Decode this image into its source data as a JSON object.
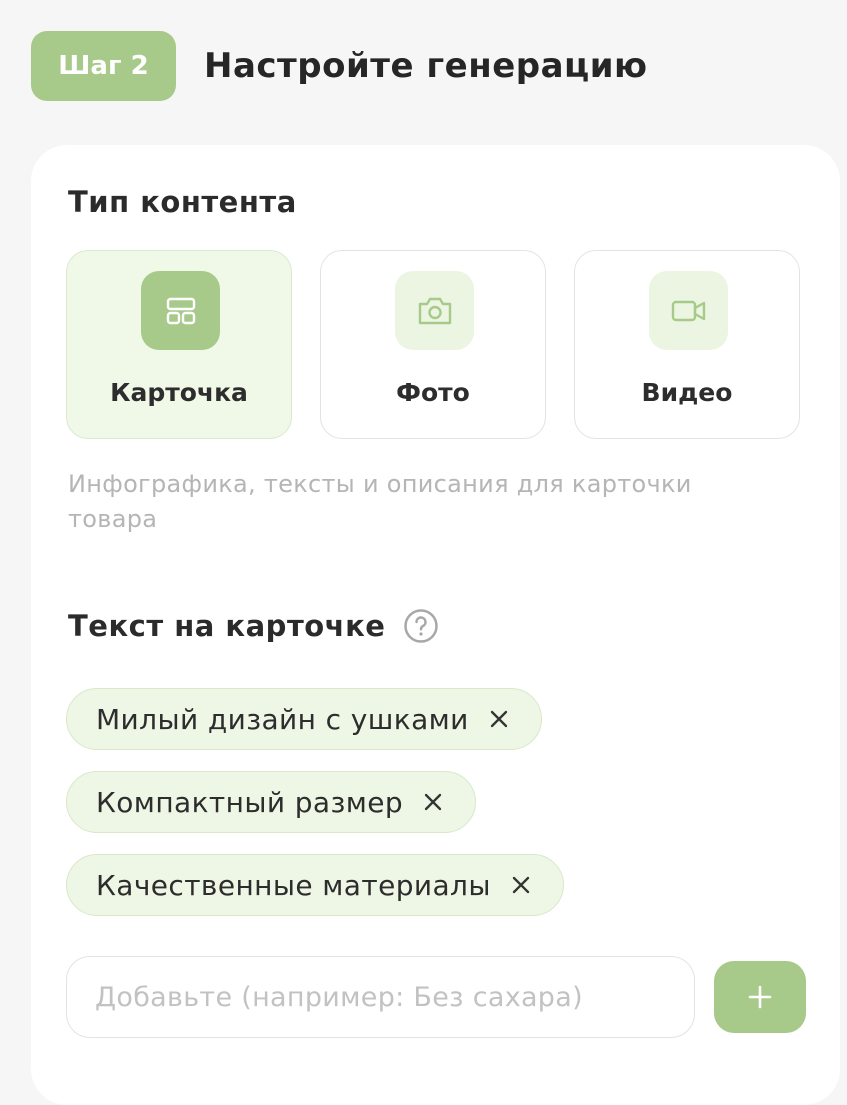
{
  "header": {
    "step_label": "Шаг 2",
    "title": "Настройте генерацию"
  },
  "content_type": {
    "title": "Тип контента",
    "options": [
      {
        "label": "Карточка",
        "icon": "layout-icon",
        "selected": true
      },
      {
        "label": "Фото",
        "icon": "camera-icon",
        "selected": false
      },
      {
        "label": "Видео",
        "icon": "video-icon",
        "selected": false
      }
    ],
    "description": "Инфографика, тексты и описания для карточки товара"
  },
  "card_text": {
    "title": "Текст на карточке",
    "help_icon": "question-circle-icon",
    "tags": [
      "Милый дизайн с ушками",
      "Компактный размер",
      "Качественные материалы"
    ],
    "input_placeholder": "Добавьте (например: Без сахара)",
    "input_value": "",
    "add_icon": "plus-icon"
  },
  "colors": {
    "accent": "#a7ca8b",
    "accent_light": "#eef7e5",
    "muted_text": "#b5b5b5"
  }
}
